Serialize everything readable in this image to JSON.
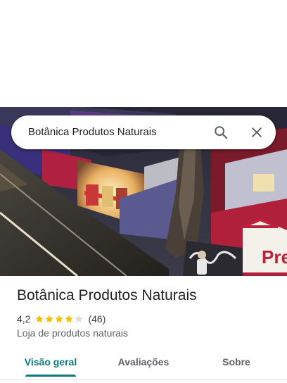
{
  "search": {
    "query": "Botânica Produtos Naturais",
    "search_icon": "search-icon",
    "close_icon": "close-icon"
  },
  "hero": {
    "storefront_sign_text": "Pre"
  },
  "place": {
    "name": "Botânica Produtos Naturais",
    "rating": "4,2",
    "stars": 4.2,
    "review_count": "(46)",
    "category": "Loja de produtos naturais"
  },
  "tabs": [
    {
      "label": "Visão geral",
      "selected": true
    },
    {
      "label": "Avaliações",
      "selected": false
    },
    {
      "label": "Sobre",
      "selected": false
    }
  ],
  "colors": {
    "accent": "#0b7b83",
    "star": "#fbbc04",
    "star_empty": "#dadce0"
  }
}
